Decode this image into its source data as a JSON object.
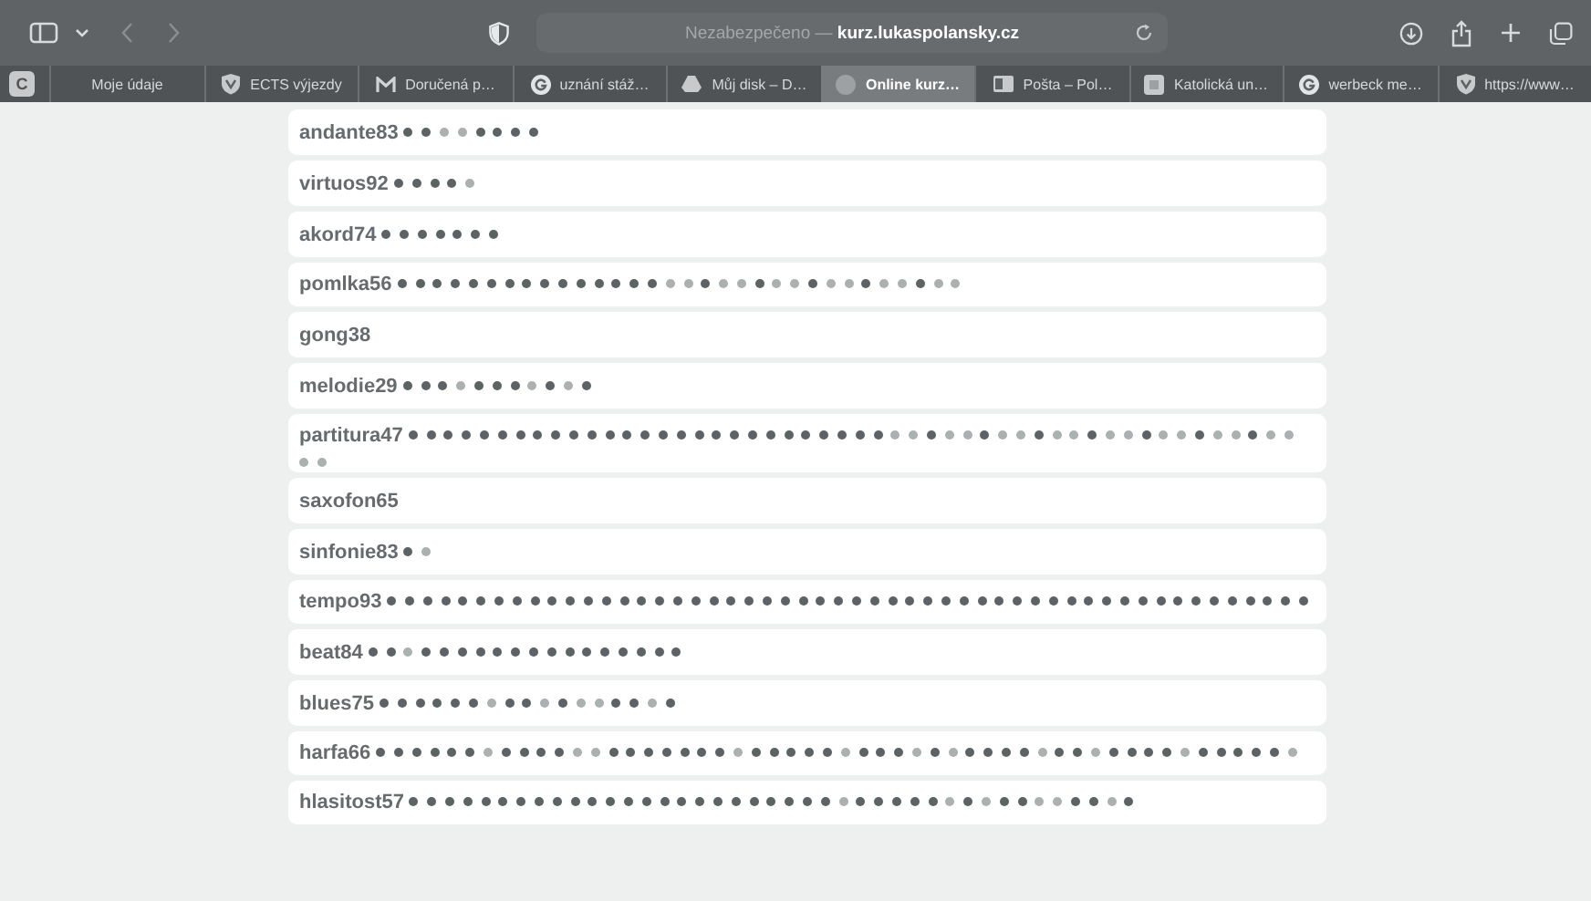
{
  "toolbar": {
    "address": {
      "security": "Nezabezpečeno",
      "separator": "—",
      "domain": "kurz.lukaspolansky.cz"
    }
  },
  "tabs": [
    {
      "label": "C",
      "kind": "pinned",
      "selected": false
    },
    {
      "label": "Moje údaje",
      "kind": "tab",
      "selected": false
    },
    {
      "label": "ECTS výjezdy",
      "kind": "tab",
      "selected": false
    },
    {
      "label": "Doručená p…",
      "kind": "tab",
      "selected": false
    },
    {
      "label": "uznání stáž…",
      "kind": "tab",
      "selected": false
    },
    {
      "label": "Můj disk – D…",
      "kind": "tab",
      "selected": false
    },
    {
      "label": "Online kurz…",
      "kind": "tab",
      "selected": true
    },
    {
      "label": "Pošta – Pol…",
      "kind": "tab",
      "selected": false
    },
    {
      "label": "Katolická un…",
      "kind": "tab",
      "selected": false
    },
    {
      "label": "werbeck me…",
      "kind": "tab",
      "selected": false
    },
    {
      "label": "https://www…",
      "kind": "tab",
      "selected": false
    }
  ],
  "rows": [
    {
      "name": "andante83",
      "dots": [
        true,
        true,
        false,
        false,
        true,
        true,
        true,
        true
      ]
    },
    {
      "name": "virtuos92",
      "dots": [
        true,
        true,
        true,
        true,
        false
      ]
    },
    {
      "name": "akord74",
      "dots": [
        true,
        true,
        true,
        true,
        true,
        true,
        true
      ]
    },
    {
      "name": "pomlka56",
      "dots": [
        true,
        true,
        true,
        true,
        true,
        true,
        true,
        true,
        true,
        true,
        true,
        true,
        true,
        true,
        true,
        false,
        false,
        true,
        false,
        false,
        true,
        false,
        false,
        true,
        false,
        false,
        true,
        false,
        false,
        true,
        false,
        false
      ]
    },
    {
      "name": "gong38",
      "dots": []
    },
    {
      "name": "melodie29",
      "dots": [
        true,
        true,
        true,
        false,
        true,
        true,
        true,
        false,
        true,
        false,
        true
      ]
    },
    {
      "name": "partitura47",
      "dots": [
        true,
        true,
        true,
        true,
        true,
        true,
        true,
        true,
        true,
        true,
        true,
        true,
        true,
        true,
        true,
        true,
        true,
        true,
        true,
        true,
        true,
        true,
        true,
        true,
        true,
        true,
        true,
        false,
        false,
        true,
        false,
        false,
        true,
        false,
        false,
        true,
        false,
        false,
        true,
        false,
        false,
        true,
        false,
        false,
        true,
        false,
        false,
        true,
        false,
        false,
        false,
        false
      ]
    },
    {
      "name": "saxofon65",
      "dots": []
    },
    {
      "name": "sinfonie83",
      "dots": [
        true,
        false
      ]
    },
    {
      "name": "tempo93",
      "dots": [
        true,
        true,
        true,
        true,
        true,
        true,
        true,
        true,
        true,
        true,
        true,
        true,
        true,
        true,
        true,
        true,
        true,
        true,
        true,
        true,
        true,
        true,
        true,
        true,
        true,
        true,
        true,
        true,
        true,
        true,
        true,
        true,
        true,
        true,
        true,
        true,
        true,
        true,
        true,
        true,
        true,
        true,
        true,
        true,
        true,
        true,
        true,
        true,
        true,
        true,
        true,
        true
      ]
    },
    {
      "name": "beat84",
      "dots": [
        true,
        true,
        false,
        true,
        true,
        true,
        true,
        true,
        true,
        true,
        true,
        true,
        true,
        true,
        true,
        true,
        true,
        true
      ]
    },
    {
      "name": "blues75",
      "dots": [
        true,
        true,
        true,
        true,
        true,
        true,
        false,
        true,
        true,
        false,
        true,
        false,
        false,
        true,
        true,
        false,
        true
      ]
    },
    {
      "name": "harfa66",
      "dots": [
        true,
        true,
        true,
        true,
        true,
        true,
        false,
        true,
        true,
        true,
        true,
        false,
        false,
        true,
        true,
        true,
        true,
        true,
        true,
        true,
        false,
        true,
        true,
        true,
        true,
        true,
        false,
        true,
        true,
        true,
        false,
        true,
        false,
        true,
        true,
        true,
        true,
        false,
        true,
        true,
        false,
        true,
        true,
        true,
        true,
        false,
        true,
        true,
        true,
        true,
        true,
        false
      ]
    },
    {
      "name": "hlasitost57",
      "dots": [
        true,
        true,
        true,
        true,
        true,
        true,
        true,
        true,
        true,
        true,
        true,
        true,
        true,
        true,
        true,
        true,
        true,
        true,
        true,
        true,
        true,
        true,
        true,
        true,
        false,
        true,
        true,
        true,
        true,
        true,
        false,
        true,
        false,
        true,
        true,
        false,
        false,
        true,
        true,
        false,
        true
      ]
    }
  ]
}
